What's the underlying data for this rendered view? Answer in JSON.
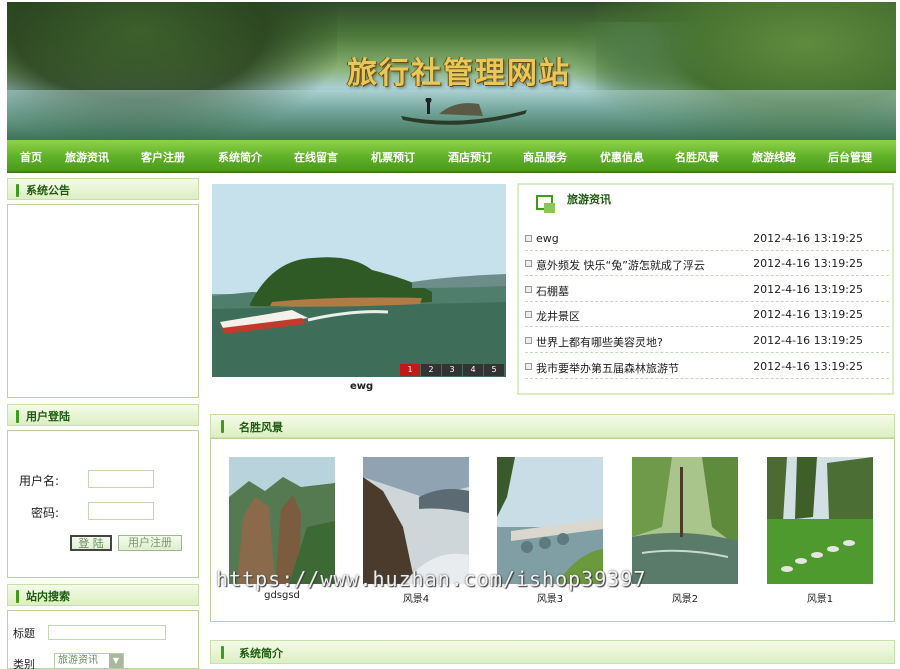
{
  "site": {
    "title": "旅行社管理网站"
  },
  "nav": [
    "首页",
    "旅游资讯",
    "客户注册",
    "系统简介",
    "在线留言",
    "机票预订",
    "酒店预订",
    "商品服务",
    "优惠信息",
    "名胜风景",
    "旅游线路",
    "后台管理"
  ],
  "notice": {
    "title": "系统公告"
  },
  "login": {
    "title": "用户登陆",
    "username_label": "用户名:",
    "password_label": "密码:",
    "login_button": "登 陆",
    "register_button": "用户注册"
  },
  "search": {
    "title": "站内搜索",
    "title_label": "标题",
    "category_label": "类别",
    "category_value": "旅游资讯"
  },
  "slideshow": {
    "pages": [
      "1",
      "2",
      "3",
      "4",
      "5"
    ],
    "active_page": "1",
    "caption": "ewg"
  },
  "news": {
    "title": "旅游资讯",
    "items": [
      {
        "title": "ewg",
        "date": "2012-4-16 13:19:25"
      },
      {
        "title": "意外频发 快乐“兔”游怎就成了浮云",
        "date": "2012-4-16 13:19:25"
      },
      {
        "title": "石棚墓",
        "date": "2012-4-16 13:19:25"
      },
      {
        "title": "龙井景区",
        "date": "2012-4-16 13:19:25"
      },
      {
        "title": "世界上都有哪些美容灵地?",
        "date": "2012-4-16 13:19:25"
      },
      {
        "title": "我市要举办第五届森林旅游节",
        "date": "2012-4-16 13:19:25"
      }
    ]
  },
  "scenery": {
    "title": "名胜风景",
    "items": [
      "gdsgsd",
      "风景4",
      "风景3",
      "风景2",
      "风景1"
    ]
  },
  "intro": {
    "title": "系统简介"
  },
  "watermark": "https://www.huzhan.com/ishop39397",
  "colors": {
    "nav_green": "#5fb128",
    "panel_border": "#b9d59a",
    "title_gold": "#e9c85a",
    "active_page": "#c41818"
  }
}
